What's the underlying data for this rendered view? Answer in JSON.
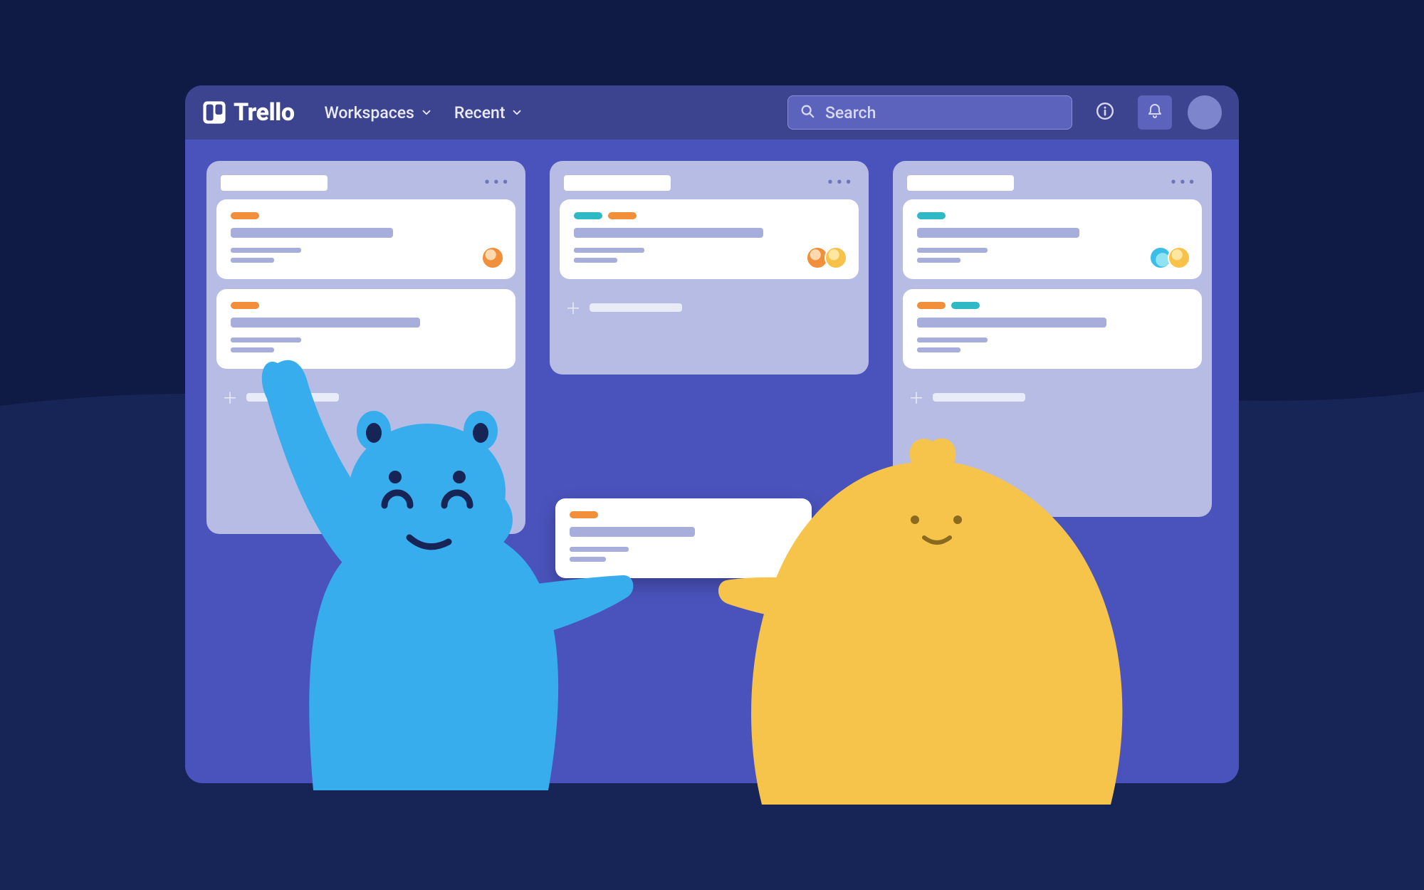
{
  "brand": {
    "name": "Trello"
  },
  "nav": {
    "workspaces": "Workspaces",
    "recent": "Recent"
  },
  "search": {
    "placeholder": "Search"
  },
  "icons": {
    "info": "info-icon",
    "bell": "bell-icon",
    "search": "search-icon",
    "chevron": "chevron-down-icon",
    "logo": "trello-logo-icon",
    "plus": "plus-icon",
    "menu": "more-icon"
  },
  "colors": {
    "page_bg": "#0F1B45",
    "page_bg_wave": "#172456",
    "window_bg": "#4A53BC",
    "topbar_bg": "#3C4490",
    "list_bg": "#B6BCE3",
    "card_bg": "#FFFFFF",
    "placeholder": "#A7AEDB",
    "label_orange": "#F18F3B",
    "label_teal": "#2FB9C5",
    "char_blue": "#37ADEE",
    "char_yellow": "#F7C44B"
  },
  "board": {
    "lists": [
      {
        "cards": [
          {
            "labels": [
              "orange"
            ],
            "members": [
              "orange"
            ]
          },
          {
            "labels": [
              "orange"
            ],
            "members": []
          }
        ],
        "show_add": true
      },
      {
        "cards": [
          {
            "labels": [
              "teal",
              "orange"
            ],
            "members": [
              "orange",
              "yellow"
            ]
          }
        ],
        "show_add": true
      },
      {
        "cards": [
          {
            "labels": [
              "teal"
            ],
            "members": [
              "blue",
              "yellow"
            ]
          },
          {
            "labels": [
              "orange",
              "teal"
            ],
            "members": []
          }
        ],
        "show_add": true
      }
    ],
    "floating_card": {
      "labels": [
        "orange"
      ],
      "members": []
    }
  }
}
